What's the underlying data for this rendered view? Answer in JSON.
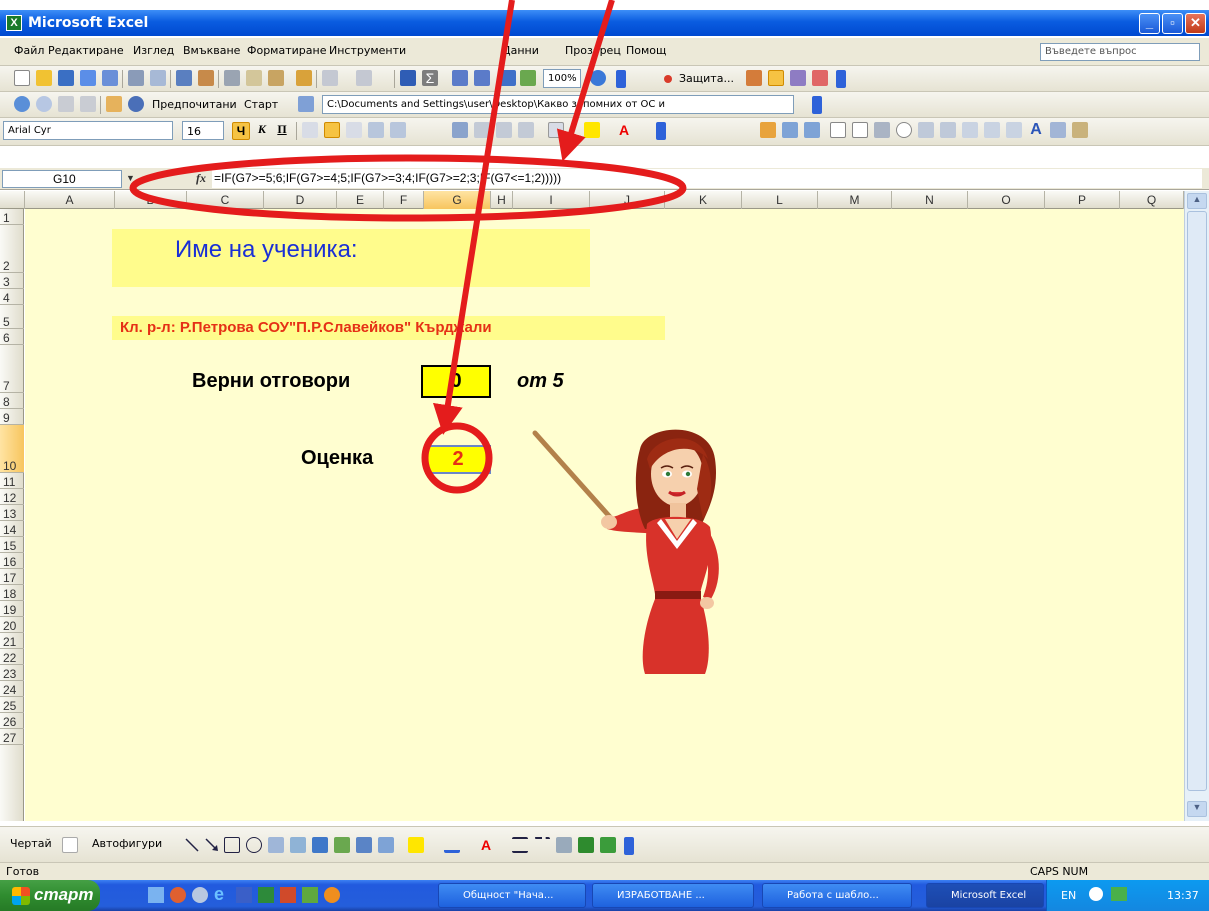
{
  "window": {
    "title": "Microsoft Excel"
  },
  "menu": {
    "items": [
      "Файл",
      "Редактиране",
      "Изглед",
      "Вмъкване",
      "Форматиране",
      "Инструменти",
      "Данни",
      "Прозорец",
      "Помощ"
    ],
    "help_placeholder": "Въведете въпрос"
  },
  "toolbar_standard": {
    "zoom": "100%",
    "protection_label": "Защита..."
  },
  "toolbar_web": {
    "favorites_label": "Предпочитани",
    "start_label": "Старт",
    "address": "C:\\Documents and Settings\\user\\Desktop\\Какво запомних от ОС и"
  },
  "toolbar_format": {
    "font_name": "Arial Cyr",
    "font_size": "16",
    "bold": "Ч",
    "italic": "К",
    "underline": "П"
  },
  "formula_bar": {
    "name_box": "G10",
    "fx": "fx",
    "formula": "=IF(G7>=5;6;IF(G7>=4;5;IF(G7>=3;4;IF(G7>=2;3;IF(G7<=1;2)))))"
  },
  "columns": [
    "A",
    "B",
    "C",
    "D",
    "E",
    "F",
    "G",
    "H",
    "I",
    "J",
    "K",
    "L",
    "M",
    "N",
    "O",
    "P",
    "Q"
  ],
  "selected_column": "G",
  "rows": [
    "1",
    "2",
    "3",
    "4",
    "5",
    "6",
    "7",
    "8",
    "9",
    "10",
    "11",
    "12",
    "13",
    "14",
    "15",
    "16",
    "17",
    "18",
    "19",
    "20",
    "21",
    "22",
    "23",
    "24",
    "25",
    "26",
    "27"
  ],
  "selected_row": "10",
  "sheet": {
    "student_name_label": "Име на ученика:",
    "teacher_line": "Кл. р-л: Р.Петрова СОУ\"П.Р.Славейков\" Кърджали",
    "correct_answers_label": "Верни отговори",
    "correct_answers_value": "0",
    "out_of_label": "от 5",
    "grade_label": "Оценка",
    "grade_value": "2"
  },
  "draw_toolbar": {
    "draw_label": "Чертай",
    "autoshapes_label": "Автофигури"
  },
  "status_bar": {
    "ready": "Готов",
    "indicators": "CAPS NUM"
  },
  "taskbar": {
    "start_label": "старт",
    "tasks": [
      "Общност \"Нача...",
      "ИЗРАБОТВАНЕ ...",
      "Работа с шабло...",
      "Microsoft Excel"
    ],
    "language": "EN",
    "clock": "13:37"
  },
  "colors": {
    "sheet_bg": "#fffed0",
    "label_blue": "#1a2fd6",
    "label_red": "#e53016",
    "highlight_yellow": "#ffff00",
    "annotation_red": "#e41c1c"
  }
}
